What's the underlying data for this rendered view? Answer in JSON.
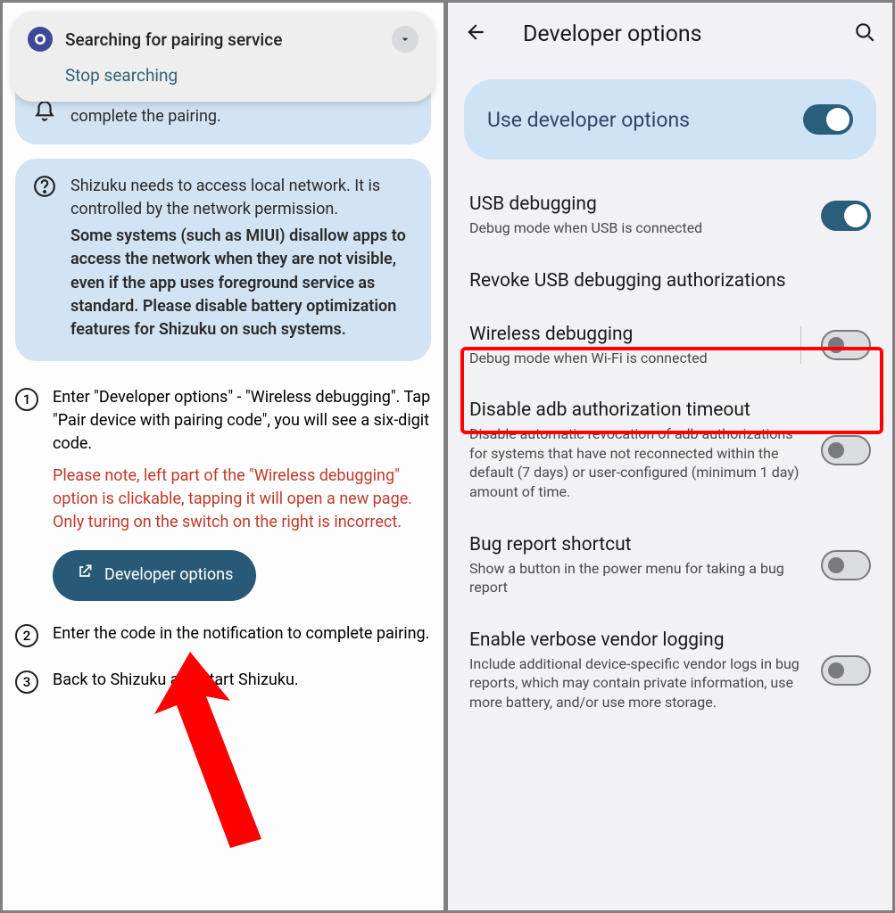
{
  "left": {
    "search_card": {
      "title": "Searching for pairing service",
      "stop": "Stop searching"
    },
    "info_partial": "A notification from Shizuku will help you complete the pairing.",
    "info_network": {
      "p1": "Shizuku needs to access local network. It is controlled by the network permission.",
      "p2": "Some systems (such as MIUI) disallow apps to access the network when they are not visible, even if the app uses foreground service as standard. Please disable battery optimization features for Shizuku on such systems."
    },
    "steps": {
      "s1": "Enter \"Developer options\" - \"Wireless debugging\". Tap \"Pair device with pairing code\", you will see a six-digit code.",
      "s1_note": "Please note, left part of the \"Wireless debugging\" option is clickable, tapping it will open a new page. Only turing on the switch on the right is incorrect.",
      "dev_btn": "Developer options",
      "s2": "Enter the code in the notification to complete pairing.",
      "s3": "Back to Shizuku and start Shizuku."
    }
  },
  "right": {
    "title": "Developer options",
    "use_dev": "Use developer options",
    "items": [
      {
        "title": "USB debugging",
        "sub": "Debug mode when USB is connected",
        "toggle": "on"
      },
      {
        "title": "Revoke USB debugging authorizations",
        "sub": "",
        "toggle": ""
      },
      {
        "title": "Wireless debugging",
        "sub": "Debug mode when Wi-Fi is connected",
        "toggle": "off",
        "vline": true
      },
      {
        "title": "Disable adb authorization timeout",
        "sub": "Disable automatic revocation of adb authorizations for systems that have not reconnected within the default (7 days) or user-configured (minimum 1 day) amount of time.",
        "toggle": "off"
      },
      {
        "title": "Bug report shortcut",
        "sub": "Show a button in the power menu for taking a bug report",
        "toggle": "off"
      },
      {
        "title": "Enable verbose vendor logging",
        "sub": "Include additional device-specific vendor logs in bug reports, which may contain private information, use more battery, and/or use more storage.",
        "toggle": "off"
      }
    ]
  }
}
